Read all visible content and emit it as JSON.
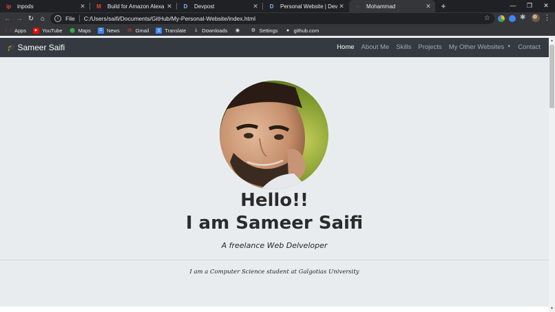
{
  "browser": {
    "tabs": [
      {
        "title": "inpods",
        "favicon": "ip",
        "favicon_color": "#e8453c"
      },
      {
        "title": "Build for Amazon Alexa in the list",
        "favicon": "M",
        "favicon_color": "#ea4335"
      },
      {
        "title": "Devpost",
        "favicon": "D",
        "favicon_color": "#7ab8ff"
      },
      {
        "title": "Personal Website | Devpost",
        "favicon": "D",
        "favicon_color": "#7ab8ff"
      },
      {
        "title": "Mohammad",
        "favicon": "◌",
        "favicon_color": "#9aa0a6"
      }
    ],
    "active_tab": 4,
    "address": {
      "scheme_label": "File",
      "url": "C:/Users/saifi/Documents/GitHub/My-Personal-Website/index.html"
    },
    "bookmarks": [
      {
        "label": "Apps",
        "icon": "apps-grid-icon",
        "color": "#ea4335"
      },
      {
        "label": "YouTube",
        "icon": "youtube-icon",
        "color": "#ff0000"
      },
      {
        "label": "Maps",
        "icon": "maps-pin-icon",
        "color": "#34a853"
      },
      {
        "label": "News",
        "icon": "news-icon",
        "color": "#4285f4"
      },
      {
        "label": "Gmail",
        "icon": "gmail-icon",
        "color": "#ea4335"
      },
      {
        "label": "Translate",
        "icon": "translate-icon",
        "color": "#4285f4"
      },
      {
        "label": "Downloads",
        "icon": "download-icon",
        "color": "#e8eaed"
      },
      {
        "label": "",
        "icon": "globe-icon",
        "color": "#e8eaed"
      },
      {
        "label": "Settings",
        "icon": "gear-icon",
        "color": "#e8eaed"
      },
      {
        "label": "github.com",
        "icon": "github-icon",
        "color": "#e8eaed"
      }
    ]
  },
  "site": {
    "brand": "Sameer Saifi",
    "nav": [
      {
        "label": "Home",
        "active": true
      },
      {
        "label": "About Me",
        "active": false
      },
      {
        "label": "Skills",
        "active": false
      },
      {
        "label": "Projects",
        "active": false
      },
      {
        "label": "My Other Websites",
        "active": false,
        "dropdown": true
      },
      {
        "label": "Contact",
        "active": false
      }
    ],
    "hero": {
      "greeting": "Hello!!",
      "name_line": "I am Sameer Saifi",
      "tagline": "A freelance Web Delveloper",
      "intro": "I am a Computer Science student at Galgotias University"
    }
  },
  "colors": {
    "navbar_bg": "#343a40",
    "page_bg": "#e9ecef",
    "chrome_dark": "#202124",
    "chrome_toolbar": "#35363a"
  }
}
